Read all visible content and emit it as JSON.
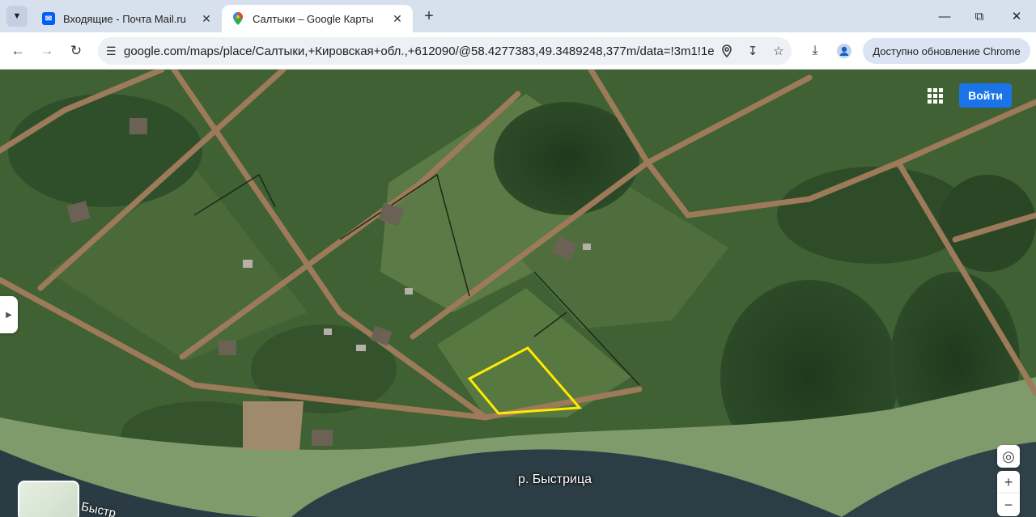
{
  "tabs": [
    {
      "title": "Входящие - Почта Mail.ru",
      "favicon": "mail-icon",
      "active": false
    },
    {
      "title": "Салтыки – Google Карты",
      "favicon": "maps-pin-icon",
      "active": true
    }
  ],
  "toolbar": {
    "url": "google.com/maps/place/Салтыки,+Кировская+обл.,+612090/@58.4277383,49.3489248,377m/data=!3m1!1e3!4m...",
    "update_label": "Доступно обновление Chrome"
  },
  "map": {
    "signin_label": "Войти",
    "river_label": "р. Быстрица",
    "river_label_partial": "Быстр",
    "view": "satellite",
    "parcel_outline_color": "#ffea00"
  },
  "colors": {
    "accent": "#1a73e8",
    "tabstrip": "#d7e1ee"
  }
}
